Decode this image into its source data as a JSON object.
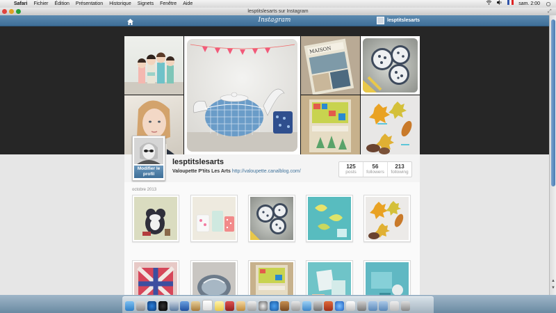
{
  "menubar": {
    "apple": "",
    "menus": [
      "Safari",
      "Fichier",
      "Édition",
      "Présentation",
      "Historique",
      "Signets",
      "Fenêtre",
      "Aide"
    ],
    "clock": "sam. 2:00"
  },
  "window": {
    "title": "lesptitslesarts sur Instagram"
  },
  "ig_header": {
    "logo": "Instagram",
    "username": "lesptitslesarts"
  },
  "profile": {
    "username": "lesptitslesarts",
    "bio_name": "Valoupette P'tits Les Arts",
    "website": "http://valoupette.canalblog.com/",
    "edit_line1": "Modifier le",
    "edit_line2": "profil",
    "stats": [
      {
        "num": "125",
        "label": "posts"
      },
      {
        "num": "56",
        "label": "followers"
      },
      {
        "num": "213",
        "label": "following"
      }
    ]
  },
  "feed": {
    "month": "octobre 2013"
  },
  "colors": {
    "accent": "#3f729b",
    "header": "#4a7aa3"
  },
  "icons": {
    "home": "home-icon",
    "user": "user-icon",
    "wifi": "wifi-icon",
    "spotlight": "search-icon"
  }
}
